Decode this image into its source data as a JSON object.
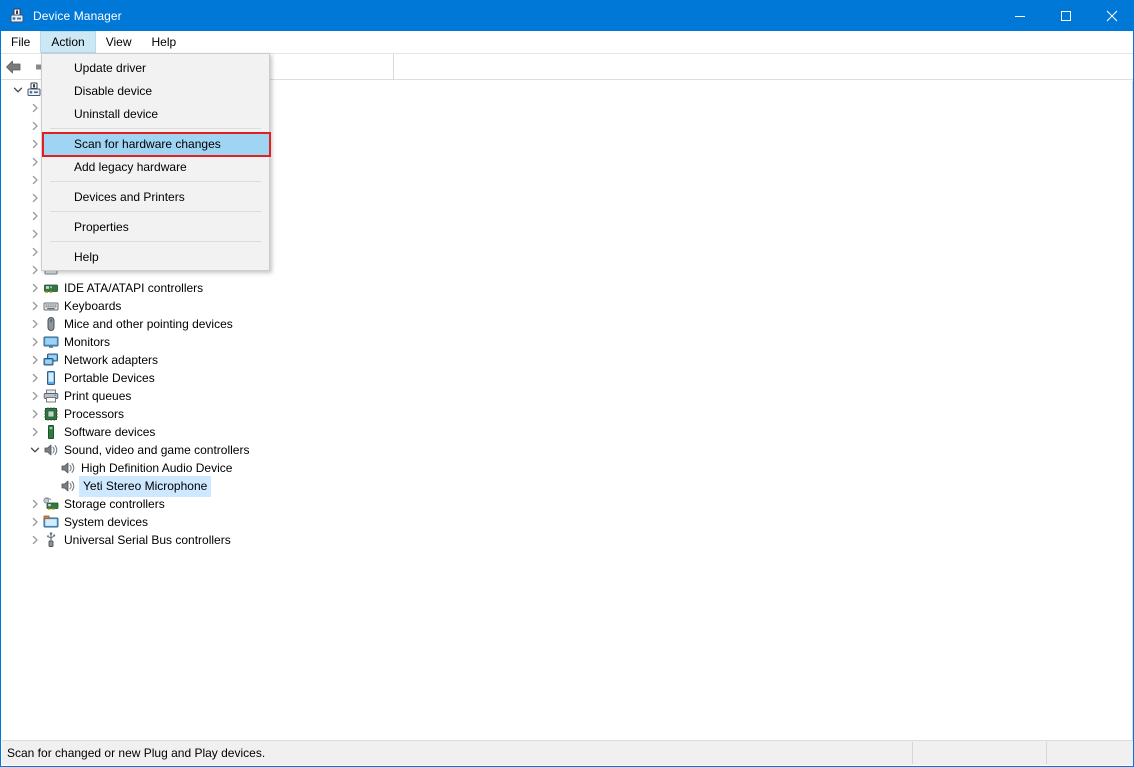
{
  "window": {
    "title": "Device Manager",
    "icon": "device-manager-icon",
    "accent_color": "#0078d7",
    "caption_buttons": [
      {
        "name": "minimize",
        "glyph": "minimize-icon"
      },
      {
        "name": "maximize",
        "glyph": "maximize-icon"
      },
      {
        "name": "close",
        "glyph": "close-icon"
      }
    ]
  },
  "menubar": {
    "items": [
      {
        "label": "File",
        "active": false
      },
      {
        "label": "Action",
        "active": true
      },
      {
        "label": "View",
        "active": false
      },
      {
        "label": "Help",
        "active": false
      }
    ]
  },
  "toolbar": {
    "buttons": [
      {
        "name": "back-button",
        "icon": "back-arrow-icon"
      },
      {
        "name": "forward-button",
        "icon": "forward-arrow-icon"
      }
    ]
  },
  "action_menu": {
    "highlighted_index": 3,
    "highlight_color": "#9fd5f3",
    "callout_color": "#e02020",
    "items": [
      {
        "label": "Update driver",
        "separator_after": false
      },
      {
        "label": "Disable device",
        "separator_after": false
      },
      {
        "label": "Uninstall device",
        "separator_after": true
      },
      {
        "label": "Scan for hardware changes",
        "separator_after": false
      },
      {
        "label": "Add legacy hardware",
        "separator_after": true
      },
      {
        "label": "Devices and Printers",
        "separator_after": true
      },
      {
        "label": "Properties",
        "separator_after": true
      },
      {
        "label": "Help",
        "separator_after": false
      }
    ]
  },
  "device_tree": {
    "selected_label": "Yeti Stereo Microphone",
    "selection_color": "#cde8ff",
    "nodes": [
      {
        "label": "",
        "depth": 0,
        "state": "expanded",
        "icon": "computer-icon",
        "hidden_label": true
      },
      {
        "label": "",
        "depth": 1,
        "state": "collapsed",
        "icon": "device-icon",
        "hidden_label": true
      },
      {
        "label": "",
        "depth": 1,
        "state": "collapsed",
        "icon": "device-icon",
        "hidden_label": true
      },
      {
        "label": "",
        "depth": 1,
        "state": "collapsed",
        "icon": "device-icon",
        "hidden_label": true
      },
      {
        "label": "",
        "depth": 1,
        "state": "collapsed",
        "icon": "device-icon",
        "hidden_label": true
      },
      {
        "label": "",
        "depth": 1,
        "state": "collapsed",
        "icon": "device-icon",
        "hidden_label": true
      },
      {
        "label": "",
        "depth": 1,
        "state": "collapsed",
        "icon": "device-icon",
        "hidden_label": true
      },
      {
        "label": "",
        "depth": 1,
        "state": "collapsed",
        "icon": "device-icon",
        "hidden_label": true
      },
      {
        "label": "",
        "depth": 1,
        "state": "collapsed",
        "icon": "device-icon",
        "hidden_label": true
      },
      {
        "label": "",
        "depth": 1,
        "state": "collapsed",
        "icon": "device-icon",
        "hidden_label": true
      },
      {
        "label": "",
        "depth": 1,
        "state": "collapsed",
        "icon": "device-icon",
        "hidden_label": true
      },
      {
        "label": "IDE ATA/ATAPI controllers",
        "depth": 1,
        "state": "collapsed",
        "icon": "ide-controller-icon",
        "hidden_label": false
      },
      {
        "label": "Keyboards",
        "depth": 1,
        "state": "collapsed",
        "icon": "keyboard-icon",
        "hidden_label": false
      },
      {
        "label": "Mice and other pointing devices",
        "depth": 1,
        "state": "collapsed",
        "icon": "mouse-icon",
        "hidden_label": false
      },
      {
        "label": "Monitors",
        "depth": 1,
        "state": "collapsed",
        "icon": "monitor-icon",
        "hidden_label": false
      },
      {
        "label": "Network adapters",
        "depth": 1,
        "state": "collapsed",
        "icon": "network-adapter-icon",
        "hidden_label": false
      },
      {
        "label": "Portable Devices",
        "depth": 1,
        "state": "collapsed",
        "icon": "portable-device-icon",
        "hidden_label": false
      },
      {
        "label": "Print queues",
        "depth": 1,
        "state": "collapsed",
        "icon": "printer-icon",
        "hidden_label": false
      },
      {
        "label": "Processors",
        "depth": 1,
        "state": "collapsed",
        "icon": "processor-icon",
        "hidden_label": false
      },
      {
        "label": "Software devices",
        "depth": 1,
        "state": "collapsed",
        "icon": "software-device-icon",
        "hidden_label": false
      },
      {
        "label": "Sound, video and game controllers",
        "depth": 1,
        "state": "expanded",
        "icon": "speaker-icon",
        "hidden_label": false
      },
      {
        "label": "High Definition Audio Device",
        "depth": 2,
        "state": "leaf",
        "icon": "speaker-icon",
        "hidden_label": false
      },
      {
        "label": "Yeti Stereo Microphone",
        "depth": 2,
        "state": "leaf",
        "icon": "speaker-icon",
        "hidden_label": false,
        "selected": true
      },
      {
        "label": "Storage controllers",
        "depth": 1,
        "state": "collapsed",
        "icon": "storage-controller-icon",
        "hidden_label": false
      },
      {
        "label": "System devices",
        "depth": 1,
        "state": "collapsed",
        "icon": "system-device-icon",
        "hidden_label": false
      },
      {
        "label": "Universal Serial Bus controllers",
        "depth": 1,
        "state": "collapsed",
        "icon": "usb-icon",
        "hidden_label": false
      }
    ]
  },
  "statusbar": {
    "message": "Scan for changed or new Plug and Play devices."
  }
}
